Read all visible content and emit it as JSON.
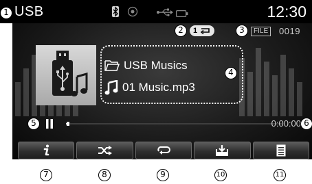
{
  "status_bar": {
    "source": "USB",
    "clock": "12:30",
    "icons": [
      "bluetooth-icon",
      "target-icon",
      "usb-icon",
      "battery-icon"
    ]
  },
  "playback_info": {
    "repeat_mode_label": "1",
    "file_label": "FILE",
    "file_number": "0019"
  },
  "media": {
    "folder": "USB Musics",
    "track": "01 Music.mp3"
  },
  "progress": {
    "elapsed": "0:00:00",
    "fraction": 0.01
  },
  "buttons": [
    {
      "name": "info-button",
      "icon": "info-icon"
    },
    {
      "name": "shuffle-button",
      "icon": "shuffle-icon"
    },
    {
      "name": "repeat-button",
      "icon": "repeat-icon"
    },
    {
      "name": "copy-button",
      "icon": "copy-icon"
    },
    {
      "name": "list-button",
      "icon": "list-icon"
    }
  ],
  "callouts": [
    "1",
    "2",
    "3",
    "4",
    "5",
    "6",
    "7",
    "8",
    "9",
    "10",
    "11"
  ],
  "colors": {
    "background": "#1b1b1b",
    "text": "#ffffff",
    "secondary_text": "#cfcfcf",
    "button_top": "#5c5c5c",
    "button_bottom": "#1e1e1e"
  }
}
